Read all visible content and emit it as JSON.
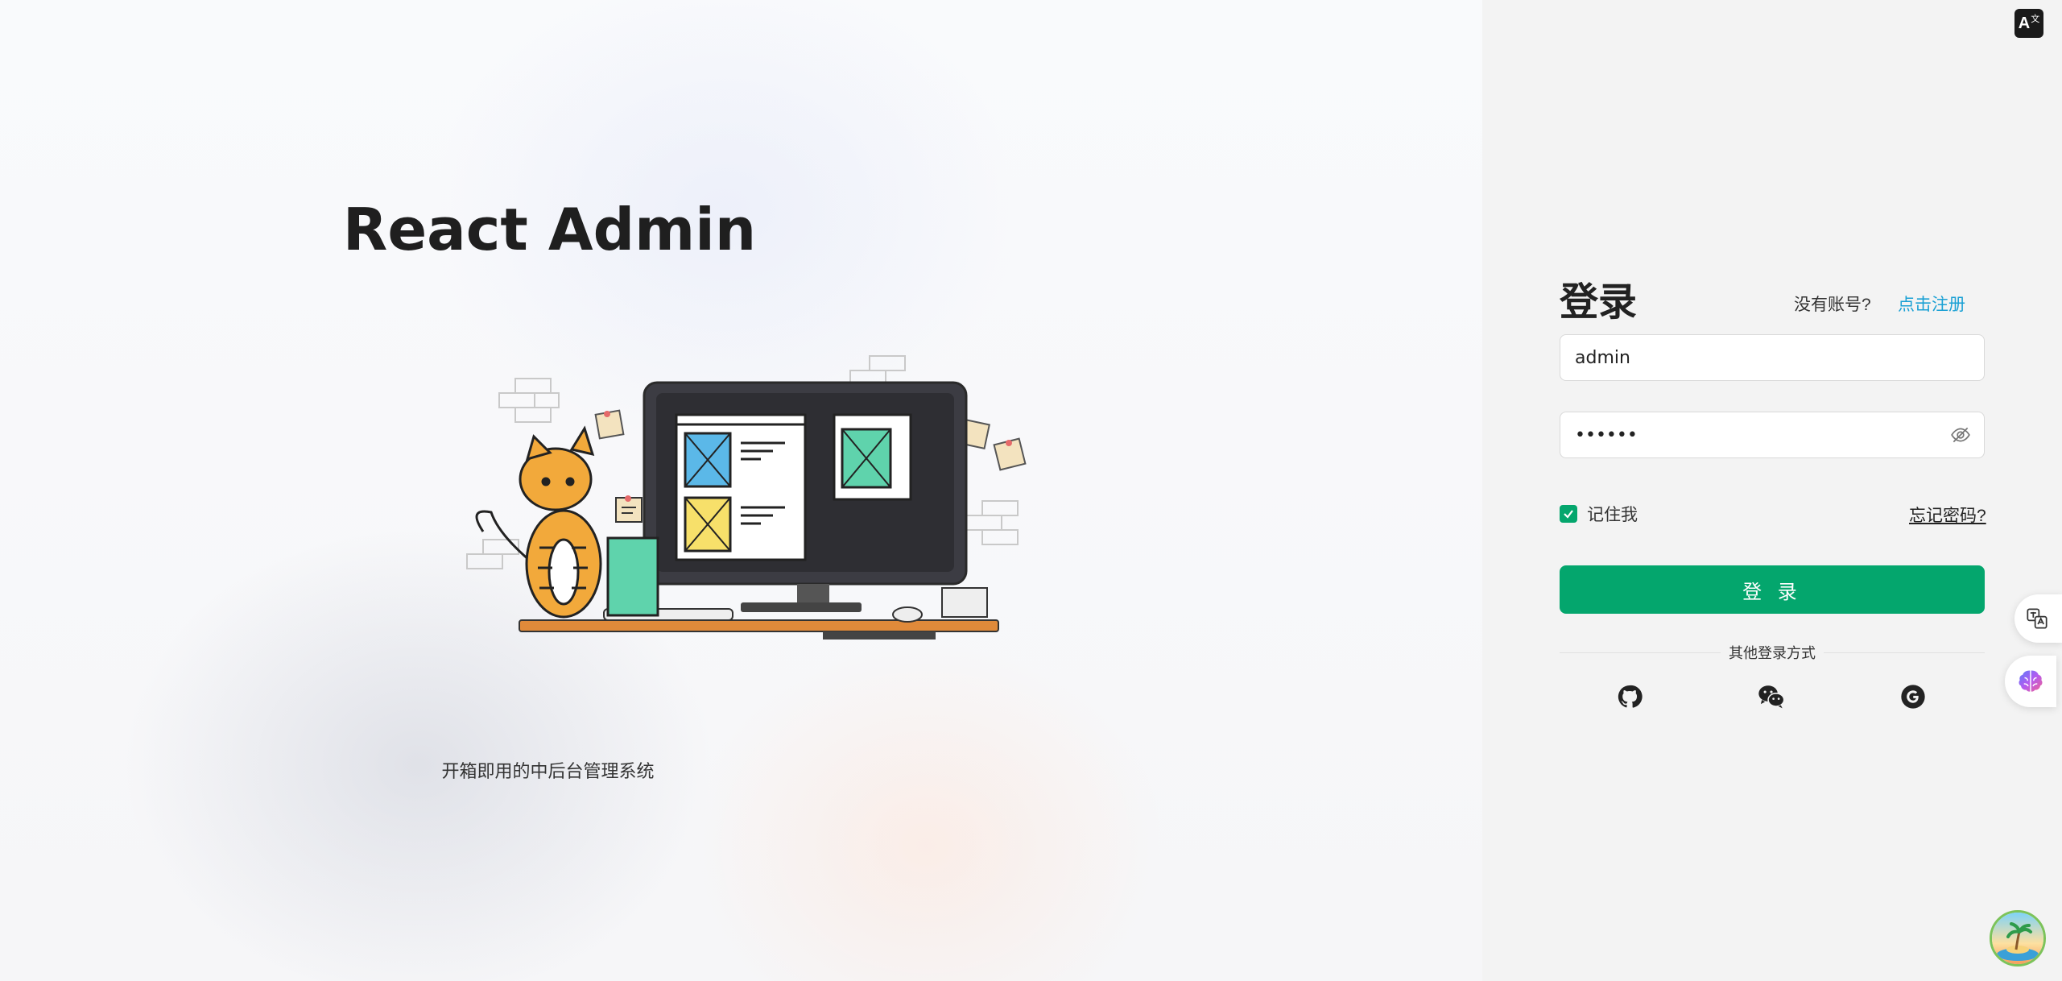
{
  "hero": {
    "title": "React Admin",
    "subtitle": "开箱即用的中后台管理系统",
    "illustration_icon": "cat-computer-illustration"
  },
  "top_right": {
    "language_icon": "translate-icon",
    "language_label": "A",
    "language_sup": "文"
  },
  "login": {
    "heading": "登录",
    "no_account_text": "没有账号?",
    "register_link": "点击注册",
    "username_value": "admin",
    "password_value": "••••••",
    "password_visibility_icon": "eye-off-icon",
    "remember_label": "记住我",
    "remember_checked": true,
    "forgot_link": "忘记密码?",
    "submit_label": "登 录",
    "other_methods_label": "其他登录方式",
    "social": [
      {
        "name": "github",
        "icon": "github-icon"
      },
      {
        "name": "wechat",
        "icon": "wechat-icon"
      },
      {
        "name": "google",
        "icon": "google-icon"
      }
    ]
  },
  "floating": {
    "translate_icon": "translate-icon",
    "brain_icon": "brain-icon",
    "avatar_icon": "island-avatar-icon"
  },
  "colors": {
    "primary": "#04a66d",
    "link": "#1aa0d4",
    "panel_bg": "#f3f3f3",
    "title": "#1f1f1f"
  }
}
